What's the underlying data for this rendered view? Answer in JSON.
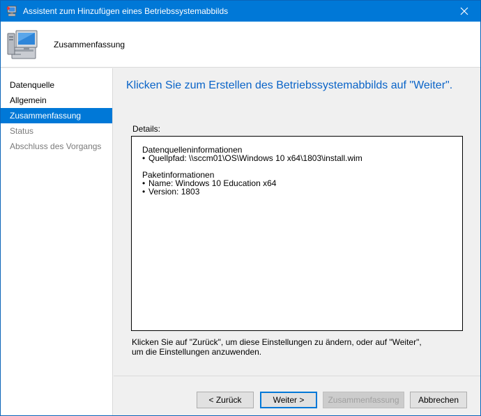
{
  "window": {
    "title": "Assistent zum Hinzufügen eines Betriebssystemabbilds",
    "close_glyph": "✕"
  },
  "header": {
    "title": "Zusammenfassung",
    "icon": "computer-icon"
  },
  "sidebar": {
    "items": [
      {
        "label": "Datenquelle",
        "state": "normal"
      },
      {
        "label": "Allgemein",
        "state": "normal"
      },
      {
        "label": "Zusammenfassung",
        "state": "active"
      },
      {
        "label": "Status",
        "state": "disabled"
      },
      {
        "label": "Abschluss des Vorgangs",
        "state": "disabled"
      }
    ]
  },
  "main": {
    "headline": "Klicken Sie zum Erstellen des Betriebssystemabbilds auf \"Weiter\".",
    "details_label": "Details:",
    "details": {
      "source_heading": "Datenquelleninformationen",
      "source_items": [
        "Quellpfad: \\\\sccm01\\OS\\Windows 10 x64\\1803\\install.wim"
      ],
      "package_heading": "Paketinformationen",
      "package_items": [
        "Name: Windows 10 Education x64",
        "Version: 1803"
      ]
    },
    "hint": "Klicken Sie auf \"Zurück\", um diese Einstellungen zu ändern, oder auf \"Weiter\", um die Einstellungen anzuwenden."
  },
  "footer": {
    "back_label": "< Zurück",
    "next_label": "Weiter >",
    "summary_label": "Zusammenfassung",
    "cancel_label": "Abbrechen"
  },
  "colors": {
    "accent": "#0078d7",
    "headline": "#0a64c8"
  }
}
